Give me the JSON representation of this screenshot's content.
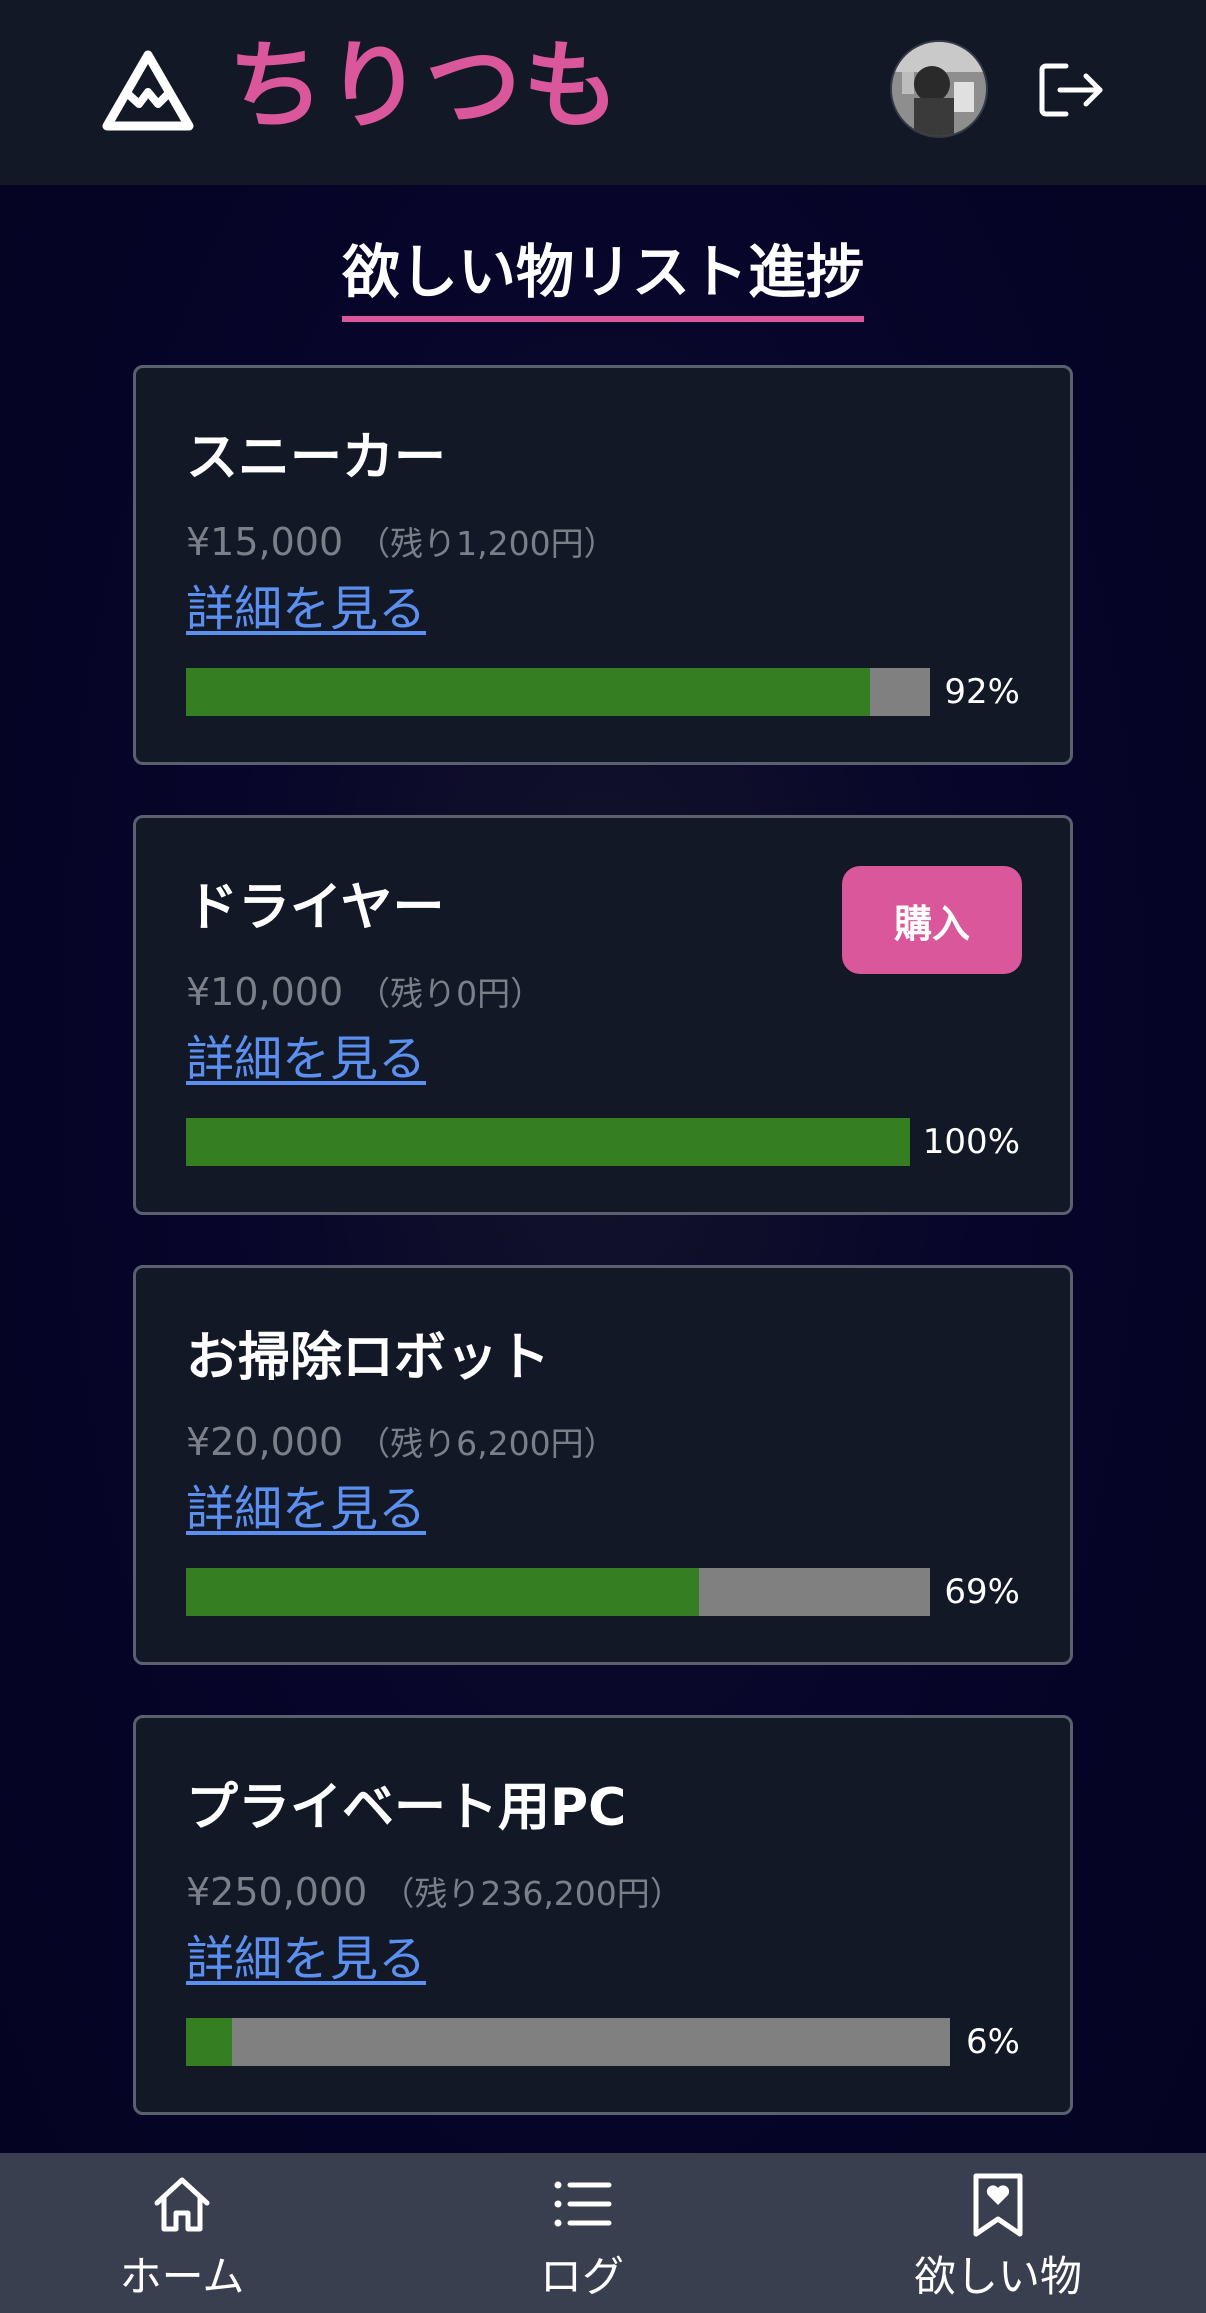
{
  "header": {
    "app_title": "ちりつも",
    "logo_icon": "mountain-icon",
    "avatar_icon": "user-avatar",
    "logout_icon": "logout-icon"
  },
  "page": {
    "title": "欲しい物リスト進捗"
  },
  "colors": {
    "accent": "#d9579a",
    "progress_fill": "#367e22",
    "progress_track": "#808080",
    "link": "#5b8ff0",
    "card_bg": "#131826"
  },
  "wishlist": [
    {
      "name": "スニーカー",
      "price": "¥15,000",
      "remaining": "（残り1,200円）",
      "link_label": "詳細を見る",
      "progress_label": "92%",
      "progress": 0.92
    },
    {
      "name": "ドライヤー",
      "price": "¥10,000",
      "remaining": "（残り0円）",
      "link_label": "詳細を見る",
      "progress_label": "100%",
      "progress": 1.0,
      "buy_label": "購入"
    },
    {
      "name": "お掃除ロボット",
      "price": "¥20,000",
      "remaining": "（残り6,200円）",
      "link_label": "詳細を見る",
      "progress_label": "69%",
      "progress": 0.69
    },
    {
      "name": "プライベート用PC",
      "price": "¥250,000",
      "remaining": "（残り236,200円）",
      "link_label": "詳細を見る",
      "progress_label": "6%",
      "progress": 0.06
    }
  ],
  "nav": {
    "home": {
      "label": "ホーム",
      "icon": "home-icon"
    },
    "log": {
      "label": "ログ",
      "icon": "list-icon"
    },
    "wishlist": {
      "label": "欲しい物",
      "icon": "bookmark-heart-icon"
    }
  }
}
